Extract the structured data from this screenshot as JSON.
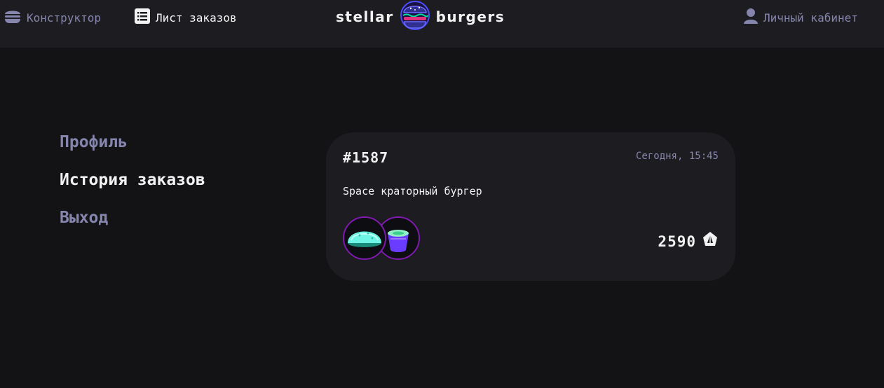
{
  "header": {
    "constructor_label": "Конструктор",
    "feed_label": "Лист заказов",
    "logo_left": "stellar",
    "logo_right": "burgers",
    "profile_label": "Личный кабинет"
  },
  "sidebar": {
    "items": [
      {
        "label": "Профиль"
      },
      {
        "label": "История заказов"
      },
      {
        "label": "Выход"
      }
    ]
  },
  "order": {
    "number": "#1587",
    "date": "Сегодня, 15:45",
    "name": "Space краторный бургер",
    "price": "2590",
    "ingredients": [
      "bun-icon",
      "sauce-icon"
    ]
  },
  "colors": {
    "background": "#131316",
    "surface": "#1c1c21",
    "muted": "#8585ad",
    "accent": "#801ab3"
  }
}
